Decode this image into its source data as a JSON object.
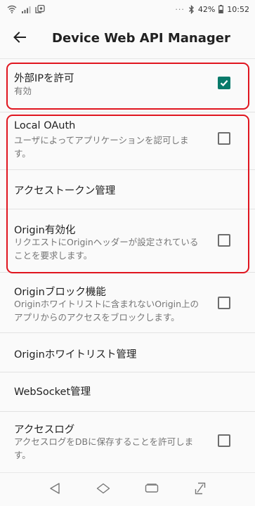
{
  "status_bar": {
    "icons": [
      "wifi-icon",
      "signal-icon",
      "notification-icon",
      "more-dots-icon",
      "bluetooth-icon",
      "battery-icon"
    ],
    "more_dots": "···",
    "battery": "42%",
    "time": "10:52"
  },
  "app_bar": {
    "title": "Device Web API Manager",
    "back_icon": "arrow-back-icon"
  },
  "settings": [
    {
      "title": "外部IPを許可",
      "summary": "有効",
      "checked": true
    },
    {
      "title": "Local OAuth",
      "summary": "ユーザによってアプリケーションを認可します。",
      "checked": false
    },
    {
      "title": "アクセストークン管理"
    },
    {
      "title": "Origin有効化",
      "summary": "リクエストにOriginヘッダーが設定されていることを要求します。",
      "checked": false
    },
    {
      "title": "Originブロック機能",
      "summary": "Originホワイトリストに含まれないOrigin上のアプリからのアクセスをブロックします。",
      "checked": false
    },
    {
      "title": "Originホワイトリスト管理"
    },
    {
      "title": "WebSocket管理"
    },
    {
      "title": "アクセスログ",
      "summary": "アクセスログをDBに保存することを許可します。",
      "checked": false
    }
  ],
  "nav_bar": {
    "icons": [
      "back-triangle-icon",
      "home-icon",
      "recents-icon",
      "screen-capture-icon"
    ]
  },
  "colors": {
    "accent": "#087a6a",
    "highlight": "#e0151f"
  }
}
